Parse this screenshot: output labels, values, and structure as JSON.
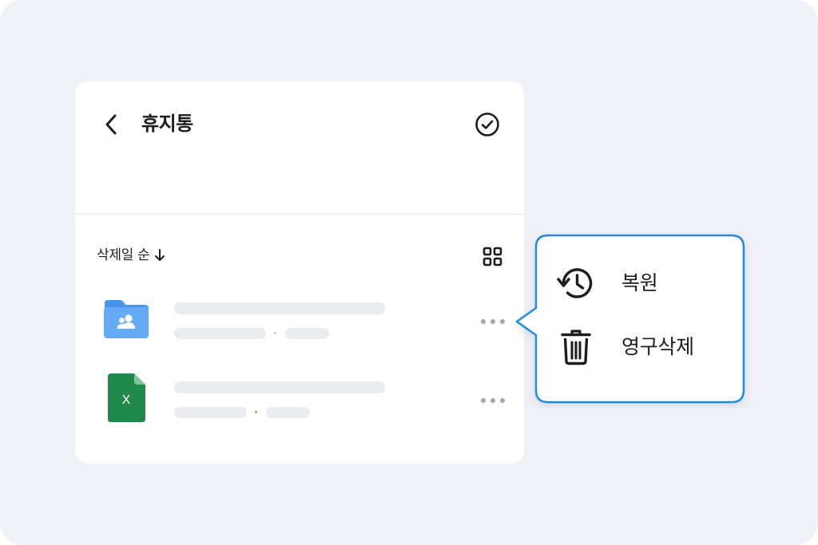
{
  "header": {
    "title": "휴지통",
    "back_icon": "chevron-left-icon",
    "select_icon": "check-circle-icon"
  },
  "sort": {
    "label": "삭제일 순",
    "direction_icon": "arrow-down-icon"
  },
  "view_toggle": {
    "icon": "grid-icon"
  },
  "files": [
    {
      "type_icon": "shared-folder-icon",
      "icon_color": "#5aa2f5",
      "separator_color": "#c3c6cc"
    },
    {
      "type_icon": "excel-file-icon",
      "icon_color": "#1f8a4c",
      "icon_letter": "X",
      "separator_color": "#e0896a"
    }
  ],
  "context_menu": {
    "border_color": "#1f8be3",
    "items": [
      {
        "label": "복원",
        "icon": "history-icon"
      },
      {
        "label": "영구삭제",
        "icon": "trash-icon"
      }
    ]
  },
  "colors": {
    "background": "#f0f1f6",
    "panel": "#ffffff",
    "skeleton": "#ebecf0",
    "text": "#1d1d1f"
  }
}
